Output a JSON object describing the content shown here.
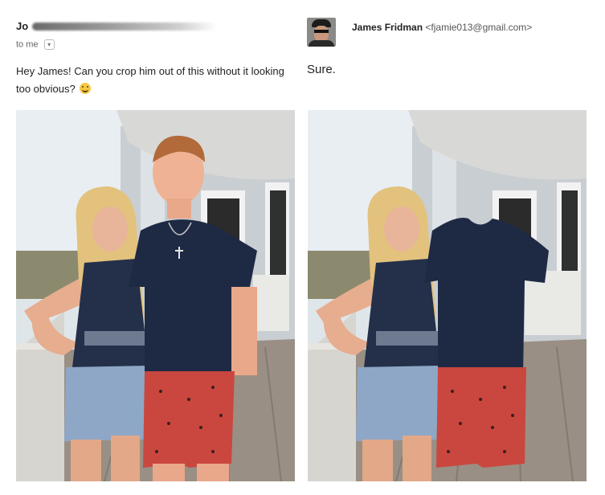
{
  "request_email": {
    "sender_name_visible": "Jo",
    "recipient_line": "to me",
    "message": "Hey James! Can you crop him out of this without it looking too obvious?",
    "emoji": "grinning-face-emoji"
  },
  "reply_email": {
    "sender_name": "James Fridman",
    "sender_email": "<fjamie013@gmail.com>",
    "message": "Sure."
  },
  "colors": {
    "shirt_navy": "#1e2a44",
    "shorts_red": "#c9473f",
    "deck_wood": "#9a8f84",
    "sky": "#e8eef2"
  }
}
